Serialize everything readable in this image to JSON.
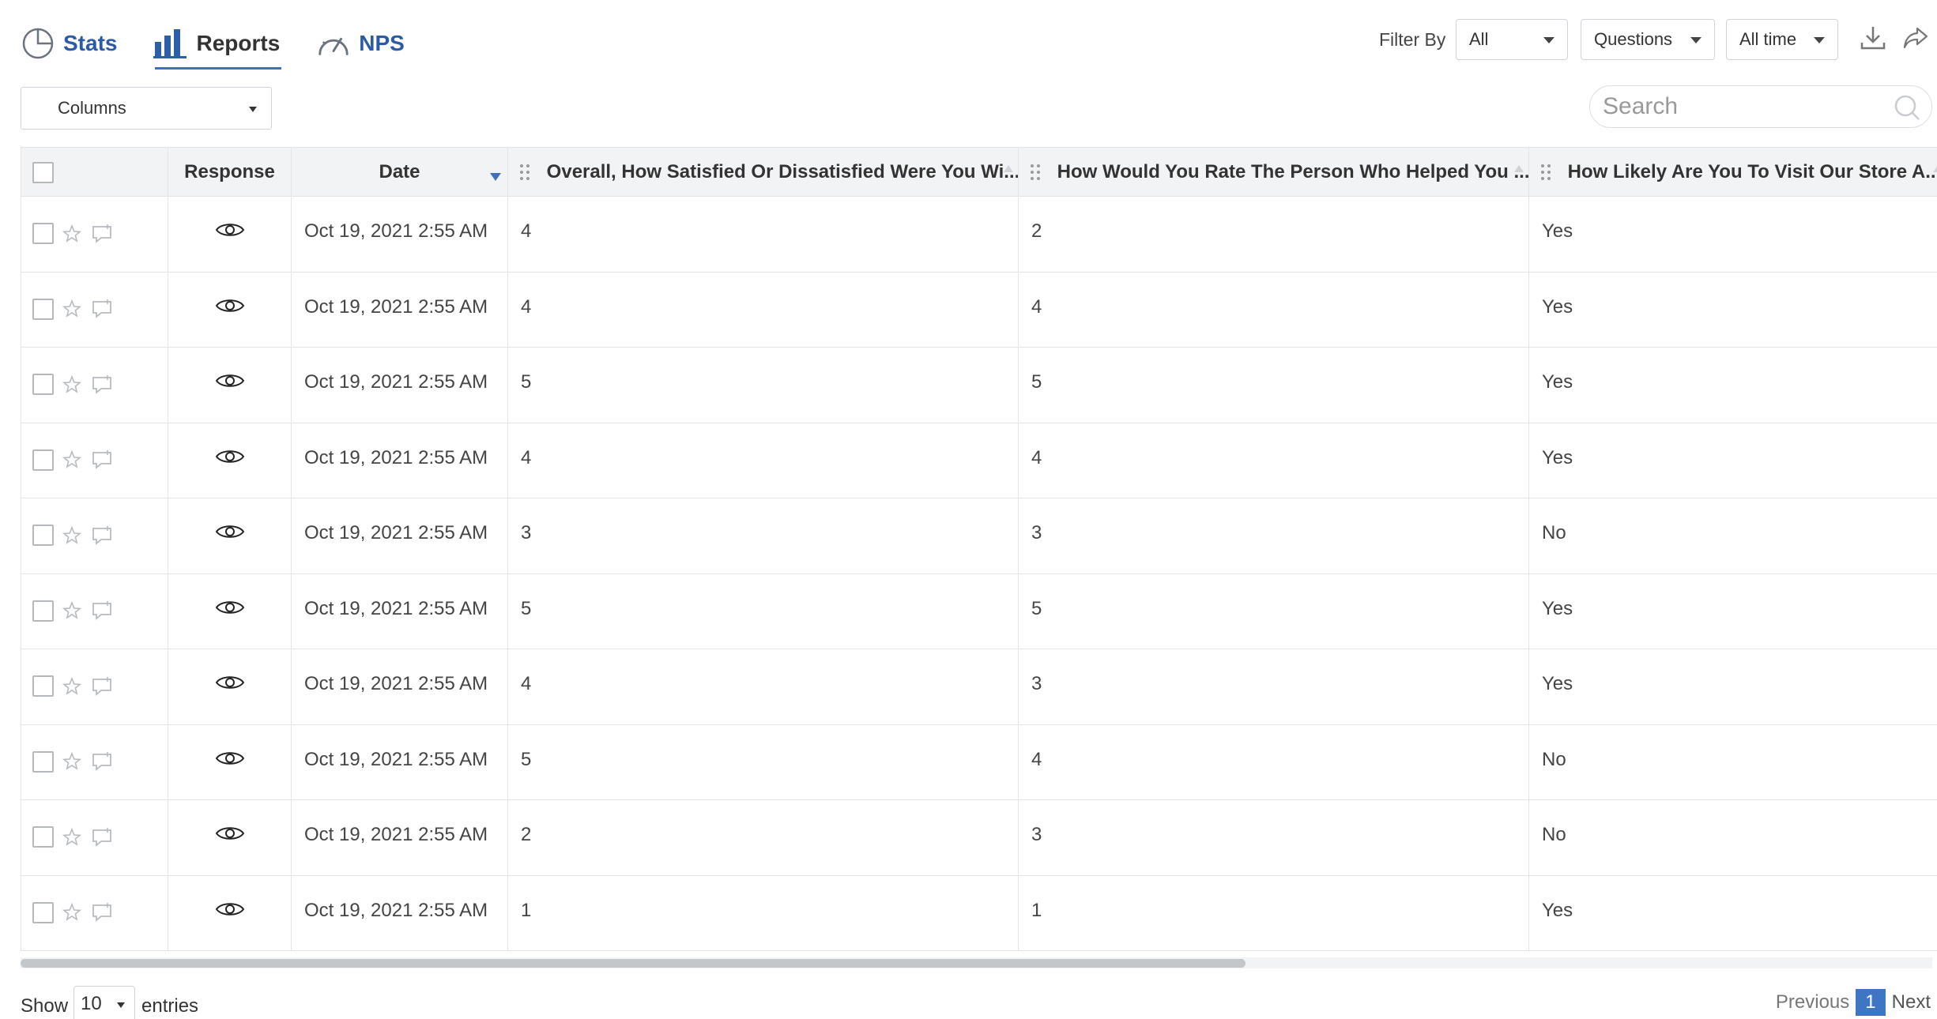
{
  "tabs": [
    {
      "label": "Stats",
      "icon": "pie-chart-icon"
    },
    {
      "label": "Reports",
      "icon": "bar-chart-icon"
    },
    {
      "label": "NPS",
      "icon": "gauge-icon"
    }
  ],
  "filter": {
    "label": "Filter By",
    "response_type": "All",
    "questions": "Questions",
    "time_range": "All time"
  },
  "columns_select": "Columns",
  "search": {
    "placeholder": "Search"
  },
  "table": {
    "headers": {
      "response": "Response",
      "date": "Date",
      "q1": "Overall, How Satisfied Or Dissatisfied Were You Wi...",
      "q2": "How Would You Rate The Person Who Helped You ...",
      "q3": "How Likely Are You To Visit Our Store A..."
    },
    "rows": [
      {
        "date": "Oct 19, 2021 2:55 AM",
        "q1": "4",
        "q2": "2",
        "q3": "Yes"
      },
      {
        "date": "Oct 19, 2021 2:55 AM",
        "q1": "4",
        "q2": "4",
        "q3": "Yes"
      },
      {
        "date": "Oct 19, 2021 2:55 AM",
        "q1": "5",
        "q2": "5",
        "q3": "Yes"
      },
      {
        "date": "Oct 19, 2021 2:55 AM",
        "q1": "4",
        "q2": "4",
        "q3": "Yes"
      },
      {
        "date": "Oct 19, 2021 2:55 AM",
        "q1": "3",
        "q2": "3",
        "q3": "No"
      },
      {
        "date": "Oct 19, 2021 2:55 AM",
        "q1": "5",
        "q2": "5",
        "q3": "Yes"
      },
      {
        "date": "Oct 19, 2021 2:55 AM",
        "q1": "4",
        "q2": "3",
        "q3": "Yes"
      },
      {
        "date": "Oct 19, 2021 2:55 AM",
        "q1": "5",
        "q2": "4",
        "q3": "No"
      },
      {
        "date": "Oct 19, 2021 2:55 AM",
        "q1": "2",
        "q2": "3",
        "q3": "No"
      },
      {
        "date": "Oct 19, 2021 2:55 AM",
        "q1": "1",
        "q2": "1",
        "q3": "Yes"
      }
    ]
  },
  "footer": {
    "show_label": "Show",
    "page_length": "10",
    "entries_label": "entries",
    "previous": "Previous",
    "current_page": "1",
    "next": "Next"
  },
  "colors": {
    "accent": "#3f6fbf",
    "tab_link": "#2b5aa8",
    "header_bg": "#f2f3f5"
  }
}
